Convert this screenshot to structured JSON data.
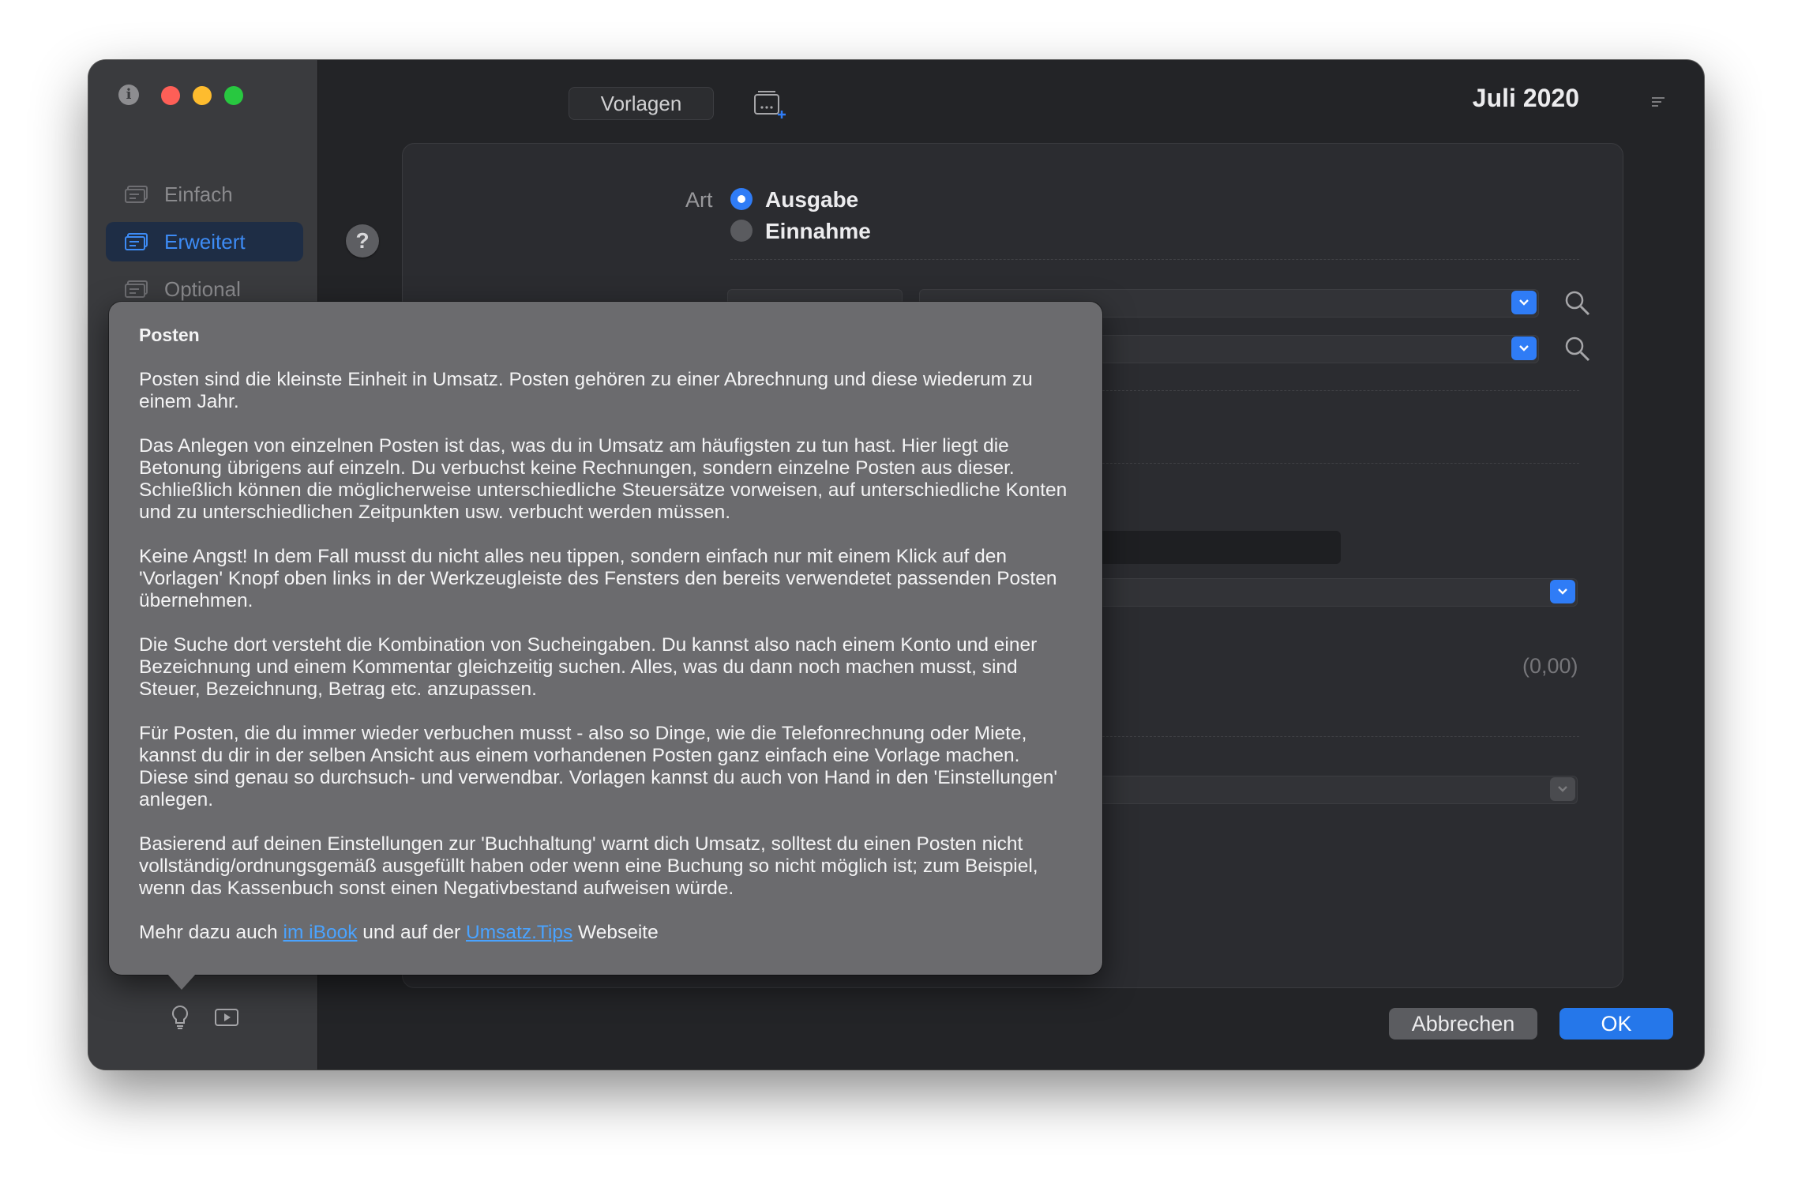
{
  "window": {
    "title": "Juli 2020"
  },
  "toolbar": {
    "templates_label": "Vorlagen"
  },
  "sidebar": {
    "items": [
      {
        "label": "Einfach"
      },
      {
        "label": "Erweitert"
      },
      {
        "label": "Optional"
      }
    ]
  },
  "form": {
    "type_label": "Art",
    "type_options": [
      "Ausgabe",
      "Einnahme"
    ],
    "selected_type": "Ausgabe",
    "amount_display": "(0,00)"
  },
  "popover": {
    "title": "Posten",
    "paragraphs": [
      "Posten sind die kleinste Einheit in Umsatz. Posten gehören zu einer Abrechnung und diese wiederum zu einem Jahr.",
      "Das Anlegen von einzelnen Posten ist das, was du in Umsatz am häufigsten zu tun hast. Hier liegt die Betonung übrigens auf einzeln. Du verbuchst keine Rechnungen, sondern einzelne Posten aus dieser. Schließlich können die möglicherweise unterschiedliche Steuersätze vorweisen, auf unterschiedliche Konten und zu unterschiedlichen Zeitpunkten usw. verbucht werden müssen.",
      "Keine Angst! In dem Fall musst du nicht alles neu tippen, sondern einfach nur mit einem Klick auf den 'Vorlagen' Knopf oben links in der Werkzeugleiste des Fensters den bereits verwendetet passenden Posten übernehmen.",
      "Die Suche dort versteht die Kombination von Sucheingaben. Du kannst also nach einem Konto und einer Bezeichnung und einem Kommentar gleichzeitig suchen. Alles, was du dann noch machen musst, sind Steuer, Bezeichnung, Betrag etc. anzupassen.",
      "Für Posten, die du immer wieder verbuchen musst - also so Dinge, wie die Telefonrechnung oder Miete, kannst du dir in der selben Ansicht aus einem vorhandenen Posten ganz einfach eine Vorlage machen. Diese sind genau so durchsuch- und verwendbar. Vorlagen kannst du auch von Hand in den 'Einstellungen' anlegen.",
      "Basierend auf deinen Einstellungen zur 'Buchhaltung' warnt dich Umsatz, solltest du einen Posten nicht vollständig/ordnungsgemäß ausgefüllt haben oder wenn eine Buchung so nicht möglich ist; zum Beispiel, wenn das Kassenbuch sonst einen Negativbestand aufweisen würde."
    ],
    "footer": {
      "prefix": "Mehr dazu auch ",
      "link1": "im iBook",
      "middle": " und auf der ",
      "link2": "Umsatz.Tips",
      "suffix": " Webseite"
    }
  },
  "buttons": {
    "cancel": "Abbrechen",
    "ok": "OK"
  },
  "colors": {
    "accent": "#2f7cf6",
    "link": "#4aa3ff",
    "close": "#fe5f57",
    "minimize": "#febc2e",
    "zoom": "#28c840"
  },
  "icons": [
    "info-icon",
    "sidebar-form-icon",
    "help-icon",
    "template-add-icon",
    "menu-icon",
    "chevron-down-icon",
    "magnifier-icon",
    "lightbulb-icon",
    "play-icon"
  ]
}
